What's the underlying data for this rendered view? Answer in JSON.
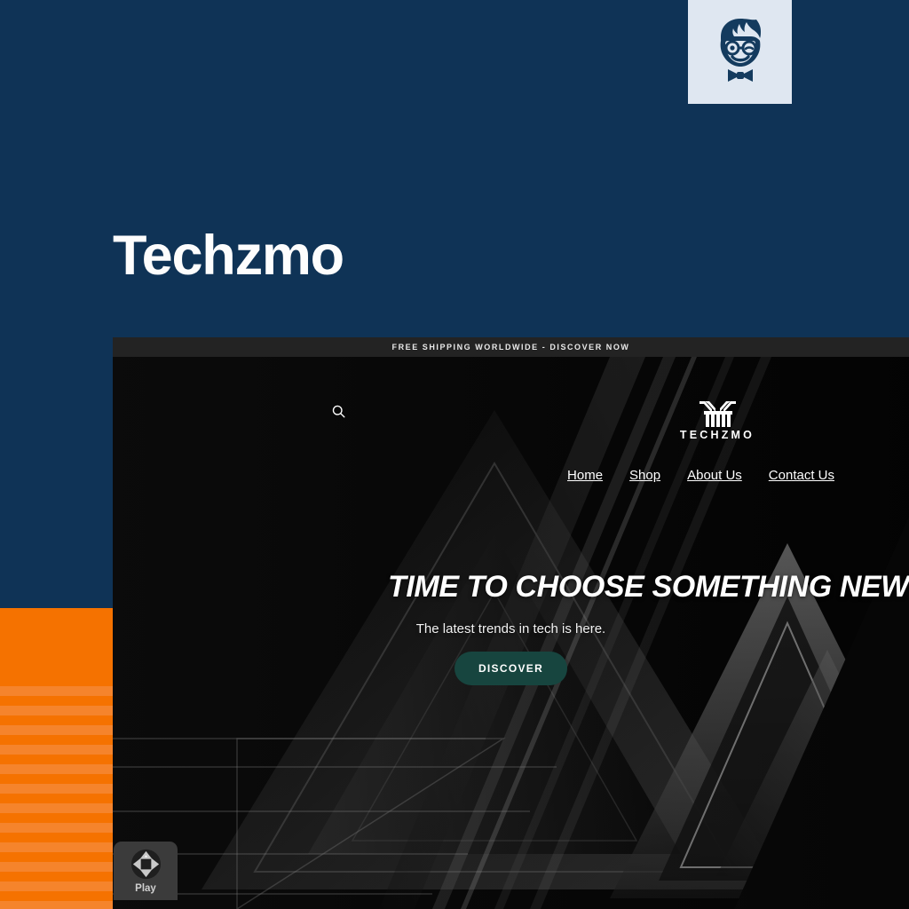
{
  "page": {
    "title": "Techzmo",
    "background_color": "#0f3356",
    "accent_orange": "#f57200",
    "accent_orange_light": "#f5842c"
  },
  "brand_chip": {
    "icon": "nerd-boy-face-icon",
    "background_color": "#dfe7f1",
    "mark_color": "#143b5e"
  },
  "orange_panel": {
    "name": "orange-striped-panel"
  },
  "site": {
    "announcement": "FREE SHIPPING WORLDWIDE - DISCOVER NOW",
    "search_icon": "search-icon",
    "logo": {
      "mark": "techzmo-t-mark-icon",
      "wordmark": "TECHZMO"
    },
    "nav": [
      {
        "label": "Home"
      },
      {
        "label": "Shop"
      },
      {
        "label": "About Us"
      },
      {
        "label": "Contact Us"
      }
    ],
    "hero": {
      "headline": "TIME TO CHOOSE SOMETHING NEW",
      "subheadline": "The latest trends in tech is here.",
      "cta_label": "DISCOVER",
      "cta_color": "#17453f"
    }
  },
  "play_widget": {
    "label": "Play",
    "icon": "dpad-icon",
    "background_color": "#3b3b3b"
  }
}
